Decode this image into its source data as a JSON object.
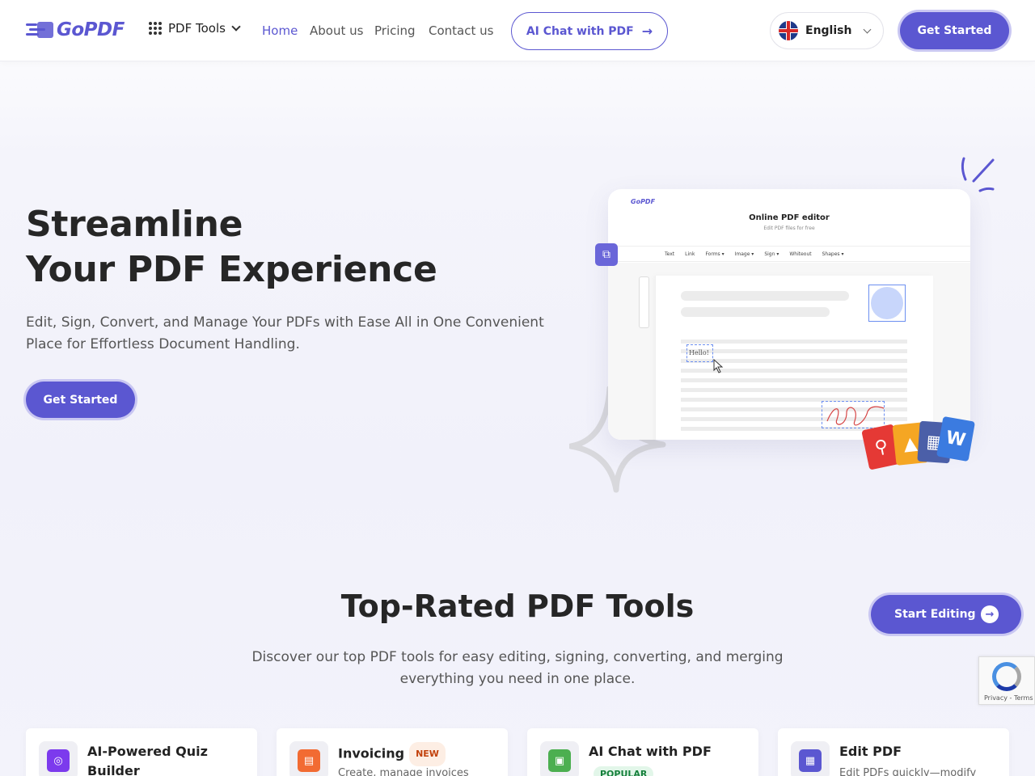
{
  "header": {
    "logo": "GoPDF",
    "tools_menu": "PDF Tools",
    "nav": [
      "Home",
      "About us",
      "Pricing",
      "Contact us"
    ],
    "ai_chat_button": "AI Chat with PDF",
    "language": "English",
    "cta": "Get Started"
  },
  "hero": {
    "title_line1": "Streamline",
    "title_line2": "Your PDF Experience",
    "subtitle": "Edit, Sign, Convert, and Manage Your PDFs with Ease All in One Convenient Place for Effortless Document Handling.",
    "cta": "Get Started"
  },
  "mockup": {
    "logo": "GoPDF",
    "title": "Online PDF editor",
    "subtitle": "Edit PDF files for free",
    "toolbar": [
      "Text",
      "Link",
      "Forms ▾",
      "Image ▾",
      "Sign ▾",
      "Whiteout",
      "Shapes ▾"
    ],
    "hello_text": "Hello!",
    "file_word_letter": "W"
  },
  "section": {
    "title": "Top-Rated PDF Tools",
    "subtitle": "Discover our top PDF tools for easy editing, signing, converting, and merging everything you need in one place.",
    "cta": "Start Editing"
  },
  "cards": [
    {
      "title": "AI-Powered Quiz Builder",
      "desc": "",
      "badge": "",
      "color": "#7c3aed"
    },
    {
      "title": "Invoicing",
      "desc": "Create, manage invoices",
      "badge": "NEW",
      "color": "#f26b32"
    },
    {
      "title": "AI Chat with PDF",
      "desc": "",
      "badge": "POPULAR",
      "color": "#4caf50"
    },
    {
      "title": "Edit PDF",
      "desc": "Edit PDFs quickly—modify",
      "badge": "",
      "color": "#5b57d1"
    }
  ],
  "recaptcha": {
    "links": "Privacy - Terms"
  },
  "colors": {
    "accent": "#5b57d1",
    "text": "#262626"
  }
}
